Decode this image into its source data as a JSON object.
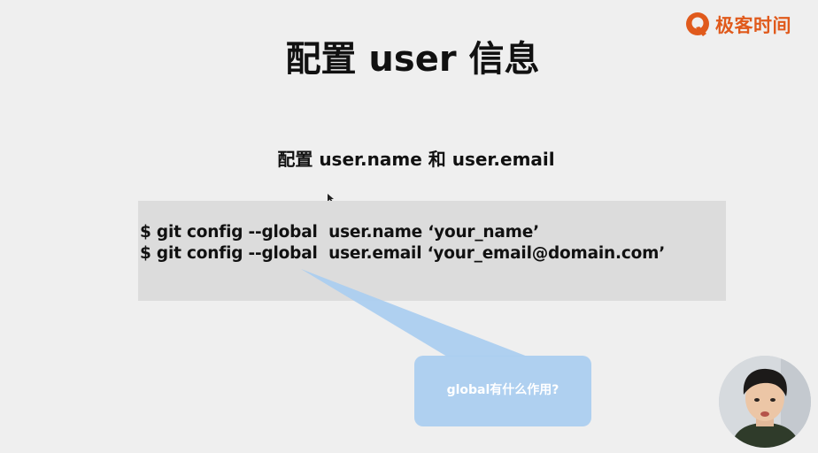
{
  "slide": {
    "title": "配置 user 信息",
    "subtitle": "配置 user.name 和 user.email",
    "code_lines": [
      "$ git config --global  user.name ‘your_name’",
      "$ git config --global  user.email ‘your_email@domain.com’"
    ],
    "callout_text": "global有什么作用?"
  },
  "brand": {
    "logo_text": "极客时间",
    "logo_icon": "geektime-logo-icon",
    "accent_color": "#e05a1c"
  },
  "colors": {
    "background": "#efefef",
    "code_box": "#dcdcdc",
    "callout": "#a9cdf0"
  },
  "webcam": {
    "icon": "presenter-video"
  }
}
